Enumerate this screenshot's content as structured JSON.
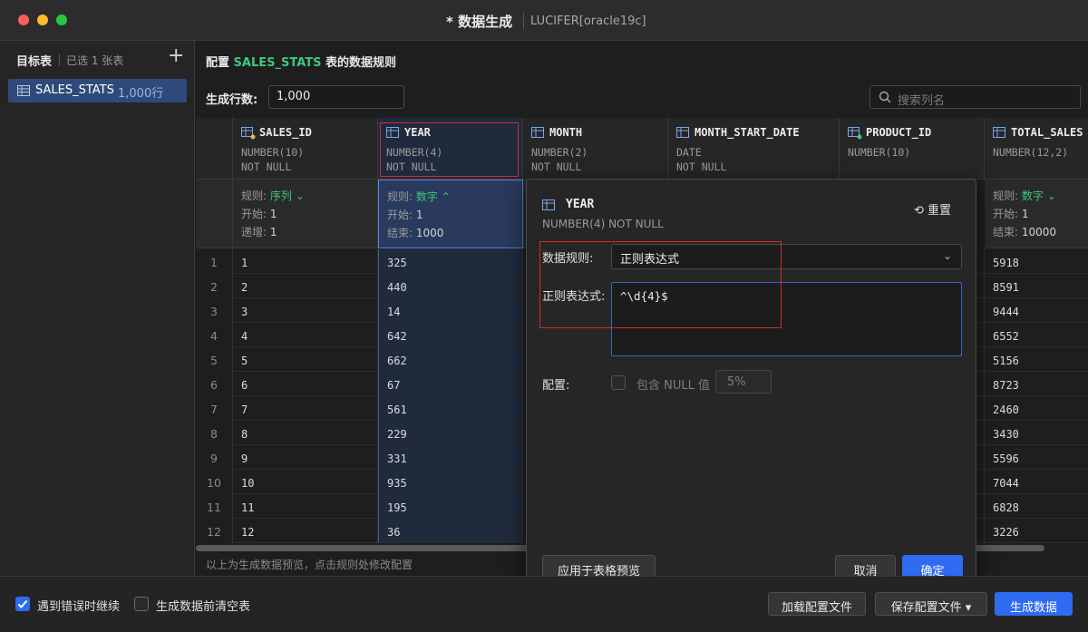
{
  "window": {
    "title": "* 数据生成",
    "subtitle": "LUCIFER[oracle19c]"
  },
  "sidebar": {
    "header": "目标表",
    "selected_count": "已选 1 张表",
    "add_label": "+",
    "items": [
      {
        "name": "SALES_STATS",
        "count": "1,000行"
      }
    ]
  },
  "main": {
    "config_prefix": "配置 ",
    "config_table": "SALES_STATS",
    "config_suffix": " 表的数据规则",
    "rows_label": "生成行数:",
    "rows_value": "1,000",
    "search_placeholder": "搜索列名",
    "hint": "以上为生成数据预览，点击规则处修改配置"
  },
  "columns": [
    {
      "name": "SALES_ID",
      "type": "NUMBER(10)",
      "nullable": "NOT NULL",
      "rule_label": "规则:",
      "rule": "序列 ⌄",
      "p1_label": "开始:",
      "p1": "1",
      "p2_label": "递增:",
      "p2": "1",
      "values": [
        "1",
        "2",
        "3",
        "4",
        "5",
        "6",
        "7",
        "8",
        "9",
        "10",
        "11",
        "12"
      ]
    },
    {
      "name": "YEAR",
      "type": "NUMBER(4)",
      "nullable": "NOT NULL",
      "rule_label": "规则:",
      "rule": "数字 ⌃",
      "p1_label": "开始:",
      "p1": "1",
      "p2_label": "结束:",
      "p2": "1000",
      "values": [
        "325",
        "440",
        "14",
        "642",
        "662",
        "67",
        "561",
        "229",
        "331",
        "935",
        "195",
        "36"
      ]
    },
    {
      "name": "MONTH",
      "type": "NUMBER(2)",
      "nullable": "NOT NULL"
    },
    {
      "name": "MONTH_START_DATE",
      "type": "DATE",
      "nullable": "NOT NULL"
    },
    {
      "name": "PRODUCT_ID",
      "type": "NUMBER(10)",
      "nullable": ""
    },
    {
      "name": "TOTAL_SALES",
      "type": "NUMBER(12,2)",
      "nullable": "",
      "rule_label": "规则:",
      "rule": "数字 ⌄",
      "p1_label": "开始:",
      "p1": "1",
      "p2_label": "结束:",
      "p2": "10000",
      "values": [
        "5918",
        "8591",
        "9444",
        "6552",
        "5156",
        "8723",
        "2460",
        "3430",
        "5596",
        "7044",
        "6828",
        "3226"
      ]
    }
  ],
  "row_numbers": [
    "1",
    "2",
    "3",
    "4",
    "5",
    "6",
    "7",
    "8",
    "9",
    "10",
    "11",
    "12"
  ],
  "popover": {
    "title": "YEAR",
    "subtitle": "NUMBER(4) NOT NULL",
    "reset_label": "重置",
    "rule_label": "数据规则:",
    "rule_value": "正则表达式",
    "regex_label": "正则表达式:",
    "regex_value": "^\\d{4}$",
    "config_label": "配置:",
    "include_null_label": "包含 NULL 值",
    "null_percent": "5%",
    "apply_label": "应用于表格预览",
    "cancel_label": "取消",
    "ok_label": "确定"
  },
  "footer": {
    "continue_on_error": "遇到错误时继续",
    "clear_table": "生成数据前清空表",
    "load_config": "加载配置文件",
    "save_config": "保存配置文件",
    "generate": "生成数据"
  },
  "colors": {
    "accent": "#2f6bf0",
    "highlight_green": "#3dc77e",
    "annotation_red": "#d42a2a"
  }
}
